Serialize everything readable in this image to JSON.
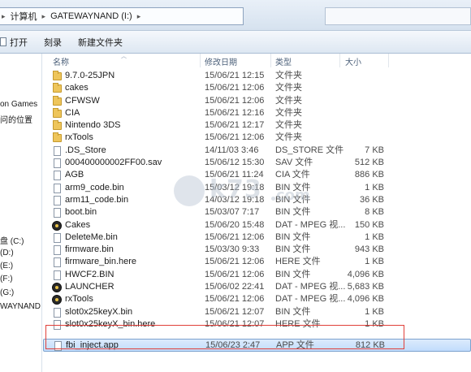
{
  "address": {
    "segments": [
      "计算机",
      "GATEWAYNAND (I:)"
    ]
  },
  "toolbar": {
    "open_label": "打开",
    "burn_label": "刻录",
    "new_folder_label": "新建文件夹"
  },
  "nav": {
    "items": [
      {
        "label": "on Games"
      },
      {
        "label": "问的位置"
      },
      {
        "label": "盘 (C:)"
      },
      {
        "label": "(D:)"
      },
      {
        "label": "(E:)"
      },
      {
        "label": "(F:)"
      },
      {
        "label": "(G:)"
      },
      {
        "label": "WAYNAND (I:"
      }
    ]
  },
  "columns": {
    "name": "名称",
    "date": "修改日期",
    "type": "类型",
    "size": "大小"
  },
  "files": [
    {
      "name": "9.7.0-25JPN",
      "date": "15/06/21 12:15",
      "type": "文件夹",
      "size": "",
      "icon": "folder-icon"
    },
    {
      "name": "cakes",
      "date": "15/06/21 12:06",
      "type": "文件夹",
      "size": "",
      "icon": "folder-icon"
    },
    {
      "name": "CFWSW",
      "date": "15/06/21 12:06",
      "type": "文件夹",
      "size": "",
      "icon": "folder-icon"
    },
    {
      "name": "CIA",
      "date": "15/06/21 12:16",
      "type": "文件夹",
      "size": "",
      "icon": "folder-icon"
    },
    {
      "name": "Nintendo 3DS",
      "date": "15/06/21 12:17",
      "type": "文件夹",
      "size": "",
      "icon": "folder-icon"
    },
    {
      "name": "rxTools",
      "date": "15/06/21 12:06",
      "type": "文件夹",
      "size": "",
      "icon": "folder-icon"
    },
    {
      "name": ".DS_Store",
      "date": "14/11/03 3:46",
      "type": "DS_STORE 文件",
      "size": "7 KB",
      "icon": "file-icon"
    },
    {
      "name": "000400000002FF00.sav",
      "date": "15/06/12 15:30",
      "type": "SAV 文件",
      "size": "512 KB",
      "icon": "file-icon"
    },
    {
      "name": "AGB",
      "date": "15/06/21 11:24",
      "type": "CIA 文件",
      "size": "886 KB",
      "icon": "file-icon"
    },
    {
      "name": "arm9_code.bin",
      "date": "15/03/12 19:18",
      "type": "BIN 文件",
      "size": "1 KB",
      "icon": "file-icon"
    },
    {
      "name": "arm11_code.bin",
      "date": "14/03/12 19:18",
      "type": "BIN 文件",
      "size": "36 KB",
      "icon": "file-icon"
    },
    {
      "name": "boot.bin",
      "date": "15/03/07 7:17",
      "type": "BIN 文件",
      "size": "8 KB",
      "icon": "file-icon"
    },
    {
      "name": "Cakes",
      "date": "15/06/20 15:48",
      "type": "DAT - MPEG 视...",
      "size": "150 KB",
      "icon": "media-icon"
    },
    {
      "name": "DeleteMe.bin",
      "date": "15/06/21 12:06",
      "type": "BIN 文件",
      "size": "1 KB",
      "icon": "file-icon"
    },
    {
      "name": "firmware.bin",
      "date": "15/03/30 9:33",
      "type": "BIN 文件",
      "size": "943 KB",
      "icon": "file-icon"
    },
    {
      "name": "firmware_bin.here",
      "date": "15/06/21 12:06",
      "type": "HERE 文件",
      "size": "1 KB",
      "icon": "file-icon"
    },
    {
      "name": "HWCF2.BIN",
      "date": "15/06/21 12:06",
      "type": "BIN 文件",
      "size": "4,096 KB",
      "icon": "file-icon"
    },
    {
      "name": "LAUNCHER",
      "date": "15/06/02 22:41",
      "type": "DAT - MPEG 视...",
      "size": "5,683 KB",
      "icon": "media-icon"
    },
    {
      "name": "rxTools",
      "date": "15/06/21 12:06",
      "type": "DAT - MPEG 视...",
      "size": "4,096 KB",
      "icon": "media-icon"
    },
    {
      "name": "slot0x25keyX.bin",
      "date": "15/06/21 12:07",
      "type": "BIN 文件",
      "size": "1 KB",
      "icon": "file-icon"
    },
    {
      "name": "slot0x25keyX_bin.here",
      "date": "15/06/21 12:07",
      "type": "HERE 文件",
      "size": "1 KB",
      "icon": "file-icon"
    },
    {
      "name": "fbi_inject.app",
      "date": "15/06/23 2:47",
      "type": "APP 文件",
      "size": "812 KB",
      "icon": "file-icon",
      "selected": true
    }
  ],
  "watermark": {
    "text": "k73",
    "suffix": "com"
  },
  "colors": {
    "highlight": "#e0403a",
    "selection": "#c1dcfc"
  }
}
